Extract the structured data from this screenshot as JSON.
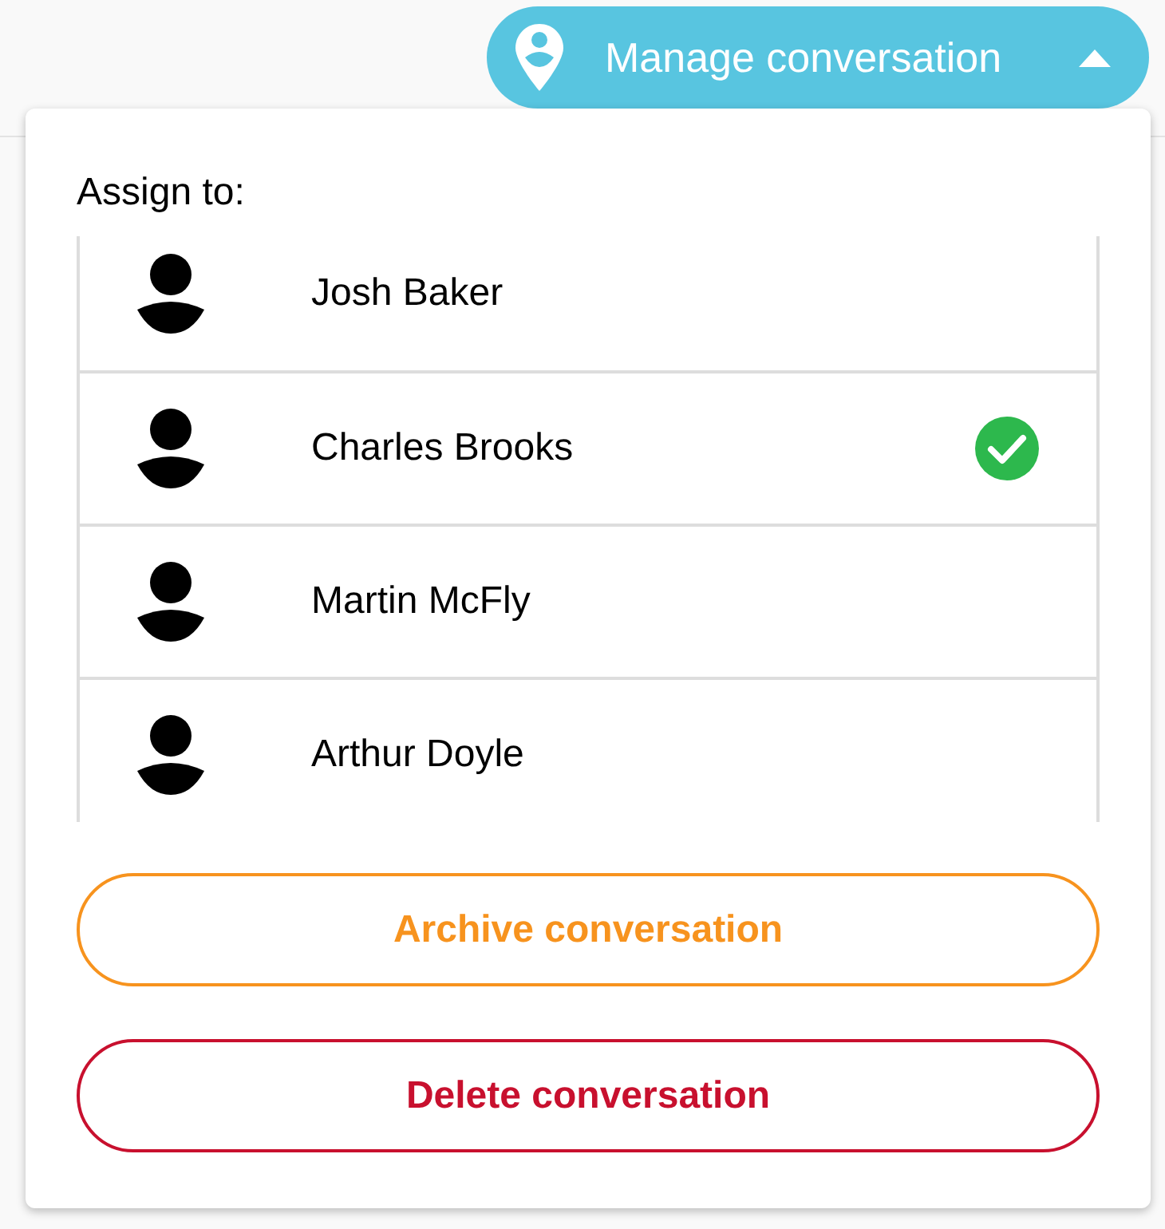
{
  "header": {
    "manage_button": {
      "label": "Manage conversation",
      "expanded": true
    }
  },
  "assign_menu": {
    "title": "Assign to:",
    "assignees": [
      {
        "name": "Josh Baker",
        "selected": false
      },
      {
        "name": "Charles Brooks",
        "selected": true
      },
      {
        "name": "Martin McFly",
        "selected": false
      },
      {
        "name": "Arthur Doyle",
        "selected": false
      }
    ],
    "actions": [
      {
        "kind": "archive",
        "label": "Archive conversation"
      },
      {
        "kind": "delete",
        "label": "Delete conversation"
      }
    ]
  }
}
